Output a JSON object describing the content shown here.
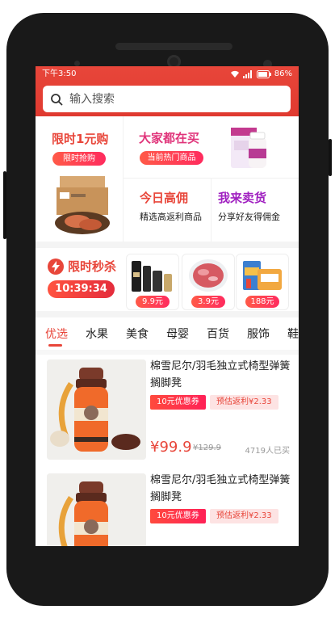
{
  "status_bar": {
    "time": "下午3:50",
    "battery": "86%"
  },
  "search": {
    "placeholder": "输入搜索"
  },
  "promo": {
    "deal": {
      "title": "限时1元购",
      "button": "限时抢购"
    },
    "popular": {
      "title": "大家都在买",
      "button": "当前热门商品"
    },
    "daily": {
      "title": "今日高佣",
      "subtitle": "精选高返利商品"
    },
    "sell": {
      "title": "我来卖货",
      "subtitle": "分享好友得佣金"
    }
  },
  "flash_sale": {
    "title": "限时秒杀",
    "timer": "10:39:34",
    "products": [
      {
        "price": "9.9元"
      },
      {
        "price": "3.9元"
      },
      {
        "price": "188元"
      }
    ]
  },
  "tabs": [
    "优选",
    "水果",
    "美食",
    "母婴",
    "百货",
    "服饰",
    "鞋"
  ],
  "items": [
    {
      "name": "棉雪尼尔/羽毛独立式椅型弹簧搁脚凳",
      "coupon": "10元优惠券",
      "rebate": "预估返利¥2.33",
      "price": "¥99.9",
      "original_price": "¥129.9",
      "sold": "4719人已买"
    },
    {
      "name": "棉雪尼尔/羽毛独立式椅型弹簧搁脚凳",
      "coupon": "10元优惠券",
      "rebate": "预估返利¥2.33"
    }
  ],
  "colors": {
    "accent": "#e8463a",
    "pink": "#e0347a",
    "purple": "#a020c0"
  }
}
